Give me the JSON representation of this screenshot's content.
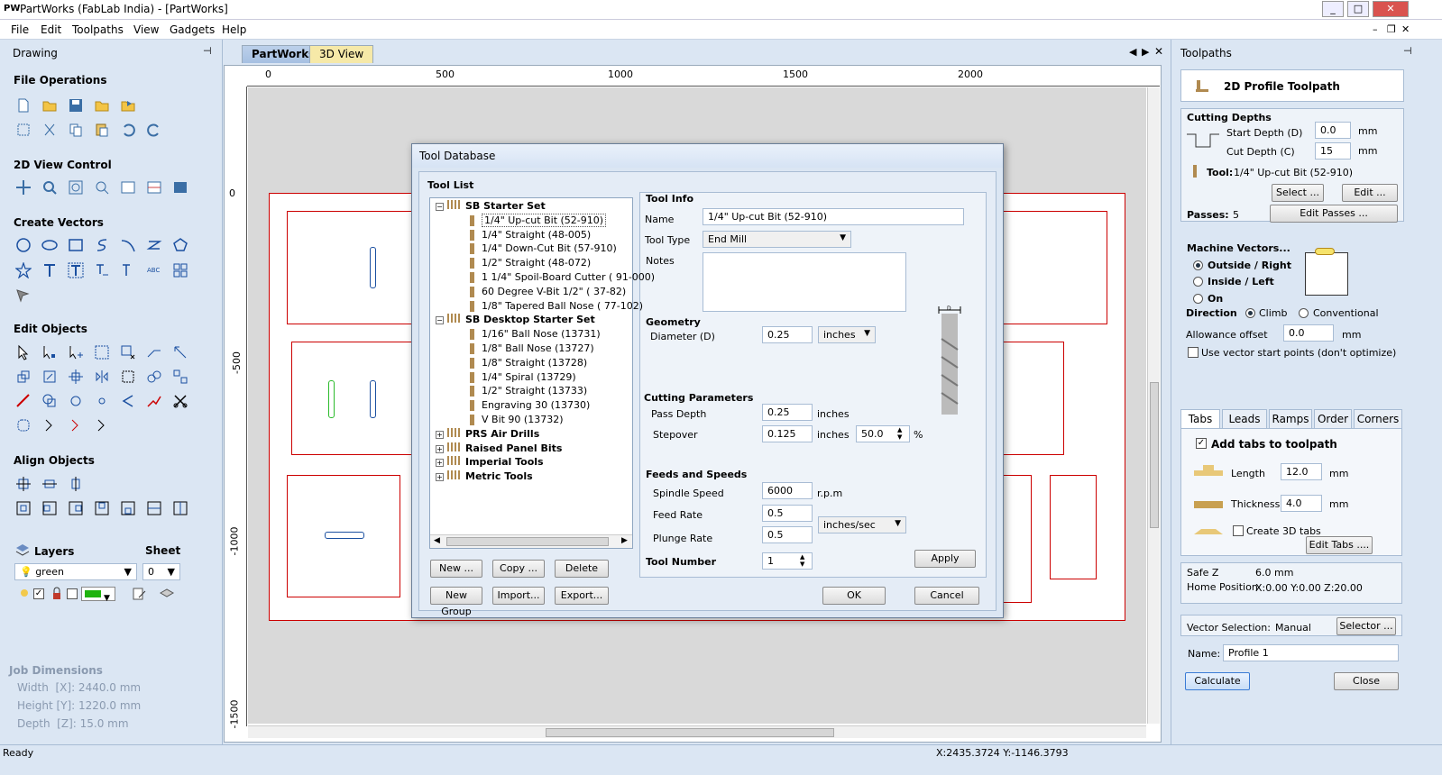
{
  "window": {
    "logo": "PW",
    "title": "PartWorks (FabLab India) - [PartWorks]",
    "controls": [
      "_",
      "□",
      "✕"
    ]
  },
  "menu": [
    "File",
    "Edit",
    "Toolpaths",
    "View",
    "Gadgets",
    "Help"
  ],
  "mdi_controls": [
    "–",
    "❐",
    "✕"
  ],
  "left_panel": {
    "title": "Drawing",
    "pin": "⊣",
    "sections": [
      "File Operations",
      "2D View Control",
      "Create Vectors",
      "Edit Objects",
      "Align Objects"
    ],
    "layers_label": "Layers",
    "sheet_label": "Sheet",
    "layer_value": "green",
    "sheet_value": "0",
    "job": {
      "title": "Job Dimensions",
      "width": "Width  [X]: 2440.0 mm",
      "height": "Height [Y]: 1220.0 mm",
      "depth": "Depth  [Z]: 15.0 mm"
    }
  },
  "doc_tabs": [
    "PartWorks",
    "3D View"
  ],
  "ruler_top": [
    "0",
    "500",
    "1000",
    "1500",
    "2000"
  ],
  "ruler_left": [
    "0",
    "-500",
    "-1000",
    "-1500"
  ],
  "dialog": {
    "title": "Tool Database",
    "tool_list_label": "Tool List",
    "tree": [
      {
        "label": "SB Starter Set",
        "bold": true,
        "level": 0,
        "expanded": true
      },
      {
        "label": "1/4\" Up-cut Bit (52-910)",
        "level": 1,
        "selected": true
      },
      {
        "label": "1/4\" Straight  (48-005)",
        "level": 1
      },
      {
        "label": "1/4\"  Down-Cut Bit (57-910)",
        "level": 1
      },
      {
        "label": "1/2\" Straight  (48-072)",
        "level": 1
      },
      {
        "label": "1 1/4\" Spoil-Board Cutter  ( 91-000)",
        "level": 1
      },
      {
        "label": "60 Degree V-Bit 1/2\"  ( 37-82)",
        "level": 1
      },
      {
        "label": "1/8\" Tapered Ball Nose  ( 77-102)",
        "level": 1
      },
      {
        "label": "SB Desktop Starter Set",
        "bold": true,
        "level": 0,
        "expanded": true
      },
      {
        "label": "1/16\" Ball Nose (13731)",
        "level": 1
      },
      {
        "label": "1/8\" Ball Nose (13727)",
        "level": 1
      },
      {
        "label": "1/8\" Straight (13728)",
        "level": 1
      },
      {
        "label": "1/4\" Spiral (13729)",
        "level": 1
      },
      {
        "label": "1/2\" Straight (13733)",
        "level": 1
      },
      {
        "label": "Engraving 30 (13730)",
        "level": 1
      },
      {
        "label": "V Bit 90 (13732)",
        "level": 1
      },
      {
        "label": "PRS Air Drills",
        "bold": true,
        "level": 0
      },
      {
        "label": "Raised Panel Bits",
        "bold": true,
        "level": 0
      },
      {
        "label": "Imperial Tools",
        "bold": true,
        "level": 0
      },
      {
        "label": "Metric Tools",
        "bold": true,
        "level": 0
      }
    ],
    "buttons": {
      "new": "New ...",
      "copy": "Copy ...",
      "delete": "Delete",
      "new_group": "New Group",
      "import": "Import...",
      "export": "Export...",
      "apply": "Apply",
      "ok": "OK",
      "cancel": "Cancel"
    },
    "tool_info": {
      "title": "Tool Info",
      "name_label": "Name",
      "name": "1/4\" Up-cut Bit (52-910)",
      "type_label": "Tool Type",
      "type": "End Mill",
      "notes_label": "Notes",
      "geometry": "Geometry",
      "diameter_label": "Diameter (D)",
      "diameter": "0.25",
      "diameter_unit": "inches",
      "cutting": "Cutting Parameters",
      "pass_depth_label": "Pass Depth",
      "pass_depth": "0.25",
      "pass_unit": "inches",
      "stepover_label": "Stepover",
      "stepover": "0.125",
      "stepover_unit": "inches",
      "stepover_pct": "50.0",
      "pct": "%",
      "feeds": "Feeds and Speeds",
      "spindle_label": "Spindle Speed",
      "spindle": "6000",
      "rpm": "r.p.m",
      "feed_label": "Feed Rate",
      "feed": "0.5",
      "plunge_label": "Plunge Rate",
      "plunge": "0.5",
      "rate_unit": "inches/sec",
      "tool_number_label": "Tool Number",
      "tool_number": "1",
      "d_label": "D"
    }
  },
  "right_panel": {
    "title": "Toolpaths",
    "pin": "⊣",
    "header": "2D Profile Toolpath",
    "cutting_depths": "Cutting Depths",
    "start_label": "Start Depth (D)",
    "start": "0.0",
    "cut_label": "Cut Depth (C)",
    "cut": "15",
    "mm": "mm",
    "tool_label": "Tool:",
    "tool": "1/4\" Up-cut Bit (52-910)",
    "select": "Select ...",
    "edit": "Edit ...",
    "passes_label": "Passes:",
    "passes": "5",
    "edit_passes": "Edit Passes ...",
    "machine_vectors": "Machine Vectors...",
    "outside": "Outside / Right",
    "inside": "Inside / Left",
    "on": "On",
    "direction": "Direction",
    "climb": "Climb",
    "conventional": "Conventional",
    "allowance_label": "Allowance offset",
    "allowance": "0.0",
    "vector_start": "Use vector start points (don't optimize)",
    "tabs": [
      "Tabs",
      "Leads",
      "Ramps",
      "Order",
      "Corners"
    ],
    "add_tabs": "Add tabs to toolpath",
    "length_label": "Length",
    "length": "12.0",
    "thickness_label": "Thickness",
    "thickness": "4.0",
    "create3d": "Create 3D tabs",
    "edit_tabs": "Edit Tabs ....",
    "safe_z_label": "Safe Z",
    "safe_z": "6.0 mm",
    "home_label": "Home Position",
    "home": "X:0.00 Y:0.00 Z:20.00",
    "vector_sel_label": "Vector Selection:",
    "vector_sel": "Manual",
    "selector": "Selector ...",
    "name_label": "Name:",
    "name": "Profile 1",
    "calculate": "Calculate",
    "close": "Close"
  },
  "status": {
    "left": "Ready",
    "coords": "X:2435.3724 Y:-1146.3793"
  }
}
